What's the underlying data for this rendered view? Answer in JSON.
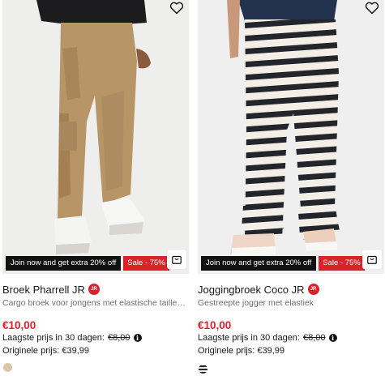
{
  "products": [
    {
      "name": "Broek Pharrell JR",
      "badge": "JR",
      "description": "Cargo broek voor jongens met elastische tailleba...",
      "promo_label": "Join now and get extra 20% off",
      "sale_label": "Sale - 75%",
      "price": "€10,00",
      "lowest_label": "Laagste prijs in 30 dagen:",
      "lowest_price": "€8,00",
      "original_label": "Originele prijs:",
      "original_price": "€39,99",
      "swatch_color": "#d9c7a8",
      "wishlist_icon": "heart-outline-icon",
      "cart_icon": "shopping-bag-icon"
    },
    {
      "name": "Joggingbroek Coco JR",
      "badge": "JR",
      "description": "Gestreepte jogger met elastiek",
      "promo_label": "Join now and get extra 20% off",
      "sale_label": "Sale - 75%",
      "price": "€10,00",
      "lowest_label": "Laagste prijs in 30 dagen:",
      "lowest_price": "€8,00",
      "original_label": "Originele prijs:",
      "original_price": "€39,99",
      "swatch_color": "#1f2430",
      "wishlist_icon": "heart-outline-icon",
      "cart_icon": "shopping-bag-icon"
    }
  ],
  "colors": {
    "sale_red": "#d8232a",
    "promo_black": "#111111"
  }
}
